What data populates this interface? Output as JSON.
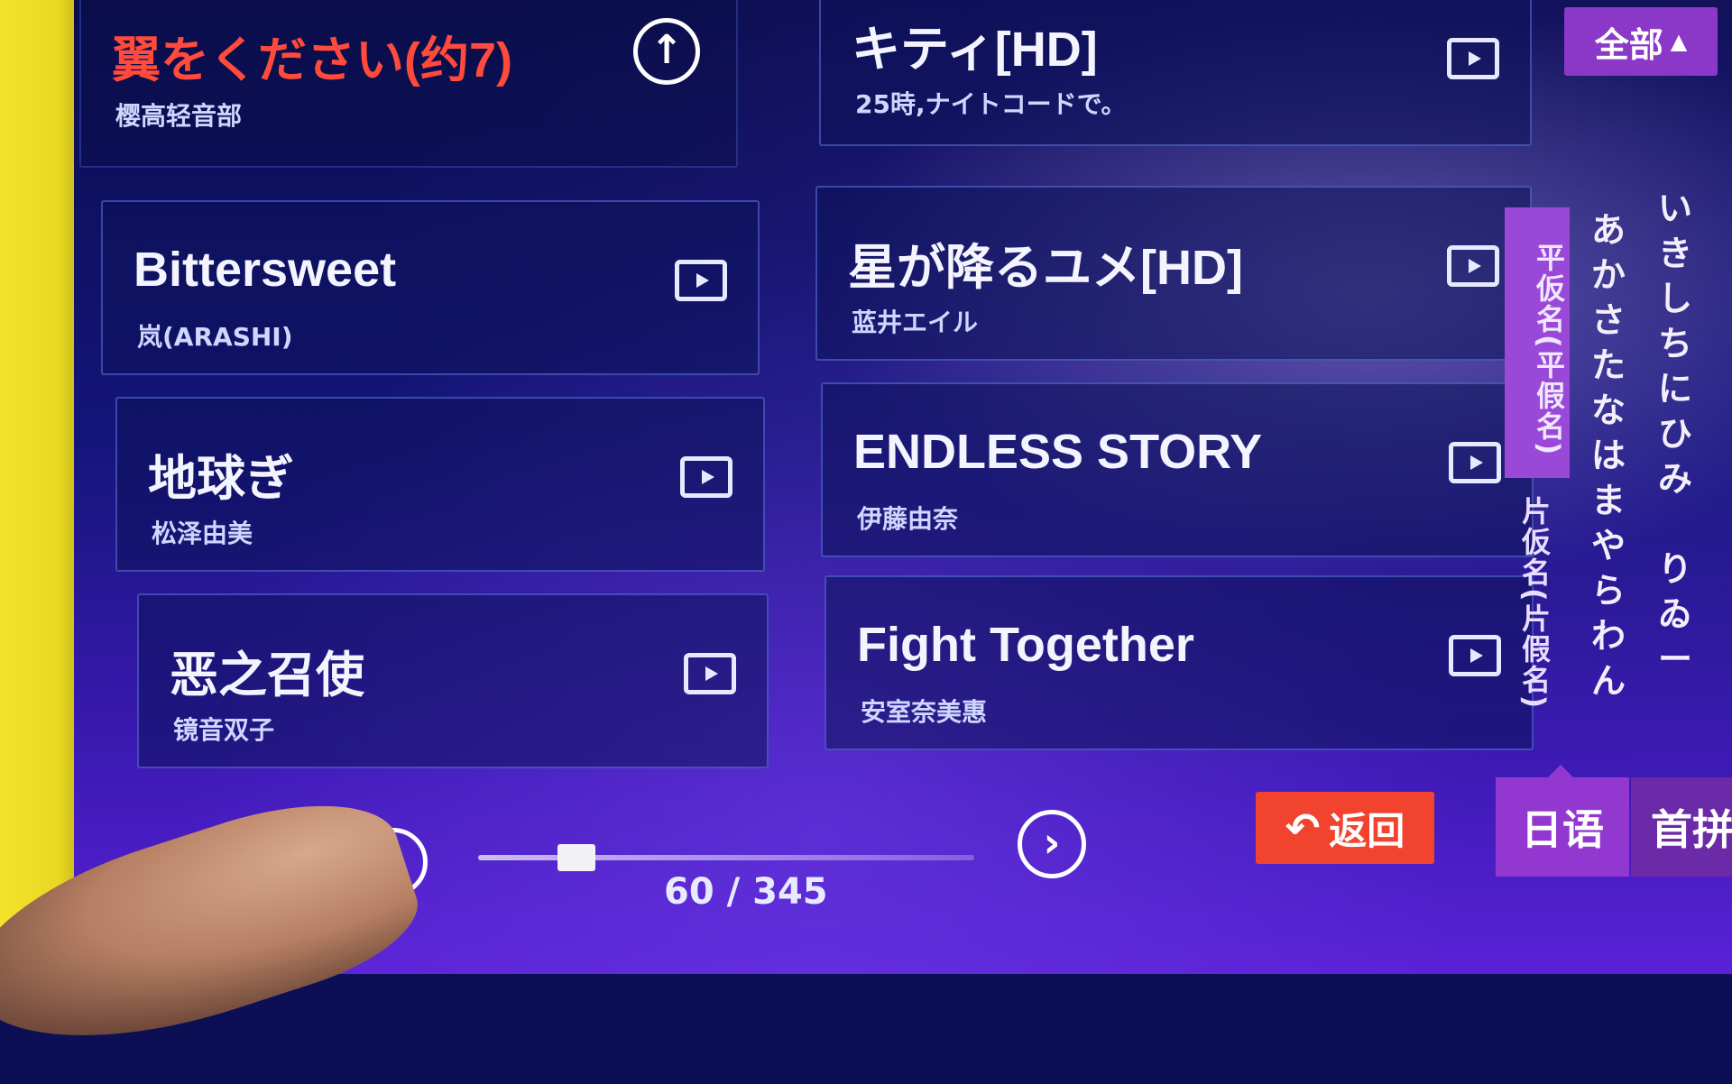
{
  "filter": {
    "label": "全部",
    "icon": "caret-up-icon"
  },
  "current_song": {
    "title": "翼をください(约7)",
    "artist": "樱高轻音部",
    "action_icon": "up-arrow-icon"
  },
  "songs": [
    {
      "title": "キティ[HD]",
      "artist": "25時,ナイトコードで。"
    },
    {
      "title": "Bittersweet",
      "artist": "岚(ARASHI)"
    },
    {
      "title": "星が降るユメ[HD]",
      "artist": "蓝井エイル"
    },
    {
      "title": "地球ぎ",
      "artist": "松泽由美"
    },
    {
      "title": "ENDLESS STORY",
      "artist": "伊藤由奈"
    },
    {
      "title": "恶之召使",
      "artist": "镜音双子"
    },
    {
      "title": "Fight Together",
      "artist": "安室奈美惠"
    }
  ],
  "index": {
    "hiragana_tab": "平仮名(平假名)",
    "katakana_tab": "片仮名(片假名)",
    "kana_columns": [
      [
        "あ",
        "か",
        "さ",
        "た",
        "な",
        "は",
        "ま",
        "や",
        "ら",
        "わ",
        "ん"
      ],
      [
        "い",
        "き",
        "し",
        "ち",
        "に",
        "ひ",
        "み",
        "",
        "り",
        "ゐ",
        "ー"
      ]
    ]
  },
  "language_tabs": {
    "japanese": "日语",
    "pinyin": "首拼"
  },
  "back_button": {
    "label": "返回",
    "icon": "back-arrow-icon"
  },
  "pagination": {
    "counter": "60 / 345",
    "current": 60,
    "total": 345
  },
  "colors": {
    "accent_purple": "#9238d0",
    "back_red": "#f2432f",
    "current_title_red": "#ff4a3c"
  }
}
